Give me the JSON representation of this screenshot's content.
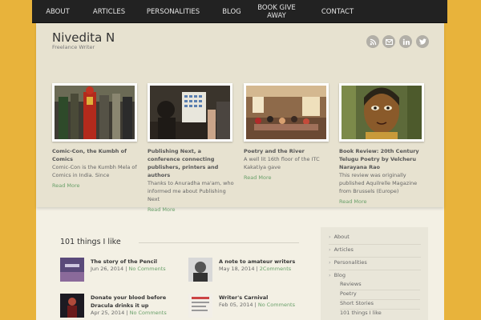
{
  "nav": {
    "items": [
      {
        "label": "ABOUT"
      },
      {
        "label": "ARTICLES"
      },
      {
        "label": "PERSONALITIES"
      },
      {
        "label": "BLOG"
      },
      {
        "label": "BOOK GIVE AWAY"
      },
      {
        "label": "CONTACT"
      }
    ]
  },
  "site": {
    "title": "Nivedita N",
    "tagline": "Freelance Writer"
  },
  "social": [
    "rss-icon",
    "email-icon",
    "linkedin-icon",
    "twitter-icon"
  ],
  "featured": [
    {
      "title": "Comic-Con, the Kumbh of Comics",
      "excerpt": "Comic-Con is the Kumbh Mela of Comics in India. Since",
      "more": "Read More"
    },
    {
      "title": "Publishing Next, a conference connecting publishers, printers and authors",
      "excerpt": "Thanks to Anuradha ma'am, who informed me about Publishing Next",
      "more": "Read More"
    },
    {
      "title": "Poetry and the River",
      "excerpt": "A well lit 16th floor of the ITC Kakatiya gave",
      "more": "Read More"
    },
    {
      "title": "Book Review: 20th Century Telugu Poetry by Velcheru Narayana Rao",
      "excerpt": "This review was originally published Aquilrelle Magazine from Brussels (Europe)",
      "more": "Read More"
    }
  ],
  "section": {
    "title": "101 things I like"
  },
  "posts": [
    {
      "title": "The story of the Pencil",
      "date": "Jun 26, 2014",
      "sep": " | ",
      "comments": "No Comments"
    },
    {
      "title": "A note to amateur writers",
      "date": "May 18, 2014",
      "sep": " | ",
      "comments": "2Comments"
    },
    {
      "title": "Donate your blood before Dracula drinks it up",
      "date": "Apr 25, 2014",
      "sep": " | ",
      "comments": "No Comments"
    },
    {
      "title": "Writer's Carnival",
      "date": "Feb 05, 2014",
      "sep": " | ",
      "comments": "No Comments"
    }
  ],
  "sidebar": {
    "items": [
      {
        "label": "About"
      },
      {
        "label": "Articles"
      },
      {
        "label": "Personalities"
      },
      {
        "label": "Blog"
      }
    ],
    "subitems": [
      {
        "label": "Reviews"
      },
      {
        "label": "Poetry"
      },
      {
        "label": "Short Stories"
      },
      {
        "label": "101 things I like"
      }
    ],
    "bullet": "›"
  },
  "colors": {
    "background": "#e8b33b",
    "nav": "#222222",
    "link": "#6aa06a"
  }
}
